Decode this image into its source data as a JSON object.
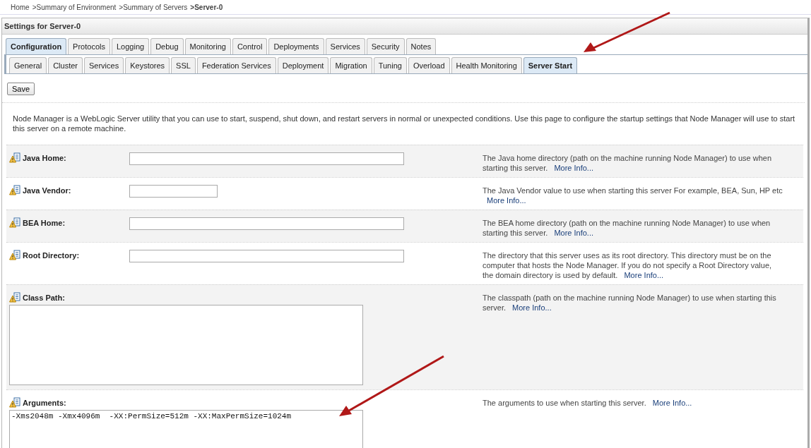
{
  "breadcrumb": [
    {
      "label": "Home",
      "current": false
    },
    {
      "label": ">Summary of Environment",
      "current": false
    },
    {
      "label": ">Summary of Servers",
      "current": false
    },
    {
      "label": ">Server-0",
      "current": true
    }
  ],
  "panel": {
    "title": "Settings for Server-0"
  },
  "tabs": [
    {
      "label": "Configuration",
      "selected": true
    },
    {
      "label": "Protocols",
      "selected": false
    },
    {
      "label": "Logging",
      "selected": false
    },
    {
      "label": "Debug",
      "selected": false
    },
    {
      "label": "Monitoring",
      "selected": false
    },
    {
      "label": "Control",
      "selected": false
    },
    {
      "label": "Deployments",
      "selected": false
    },
    {
      "label": "Services",
      "selected": false
    },
    {
      "label": "Security",
      "selected": false
    },
    {
      "label": "Notes",
      "selected": false
    }
  ],
  "subtabs": [
    {
      "label": "General",
      "selected": false
    },
    {
      "label": "Cluster",
      "selected": false
    },
    {
      "label": "Services",
      "selected": false
    },
    {
      "label": "Keystores",
      "selected": false
    },
    {
      "label": "SSL",
      "selected": false
    },
    {
      "label": "Federation Services",
      "selected": false
    },
    {
      "label": "Deployment",
      "selected": false
    },
    {
      "label": "Migration",
      "selected": false
    },
    {
      "label": "Tuning",
      "selected": false
    },
    {
      "label": "Overload",
      "selected": false
    },
    {
      "label": "Health Monitoring",
      "selected": false
    },
    {
      "label": "Server Start",
      "selected": true
    }
  ],
  "save_button": "Save",
  "intro": "Node Manager is a WebLogic Server utility that you can use to start, suspend, shut down, and restart servers in normal or unexpected conditions. Use this page to configure the startup settings that Node Manager will use to start this server on a remote machine.",
  "fields": [
    {
      "kind": "text",
      "label": "Java Home:",
      "help": "The Java home directory (path on the machine running Node Manager) to use when starting this server.",
      "more": "More Info..."
    },
    {
      "kind": "short-text",
      "label": "Java Vendor:",
      "help": "The Java Vendor value to use when starting this server For example, BEA, Sun, HP etc",
      "more": "More Info..."
    },
    {
      "kind": "text",
      "label": "BEA Home:",
      "help": "The BEA home directory (path on the machine running Node Manager) to use when starting this server.",
      "more": "More Info..."
    },
    {
      "kind": "text",
      "label": "Root Directory:",
      "help": "The directory that this server uses as its root directory. This directory must be on the computer that hosts the Node Manager. If you do not specify a Root Directory value, the domain directory is used by default.",
      "more": "More Info..."
    },
    {
      "kind": "textarea",
      "label": "Class Path:",
      "help": "The classpath (path on the machine running Node Manager) to use when starting this server.",
      "more": "More Info..."
    },
    {
      "kind": "textarea",
      "label": "Arguments:",
      "value": "-Xms2048m -Xmx4096m  -XX:PermSize=512m -XX:MaxPermSize=1024m",
      "help": "The arguments to use when starting this server.",
      "more": "More Info..."
    }
  ]
}
